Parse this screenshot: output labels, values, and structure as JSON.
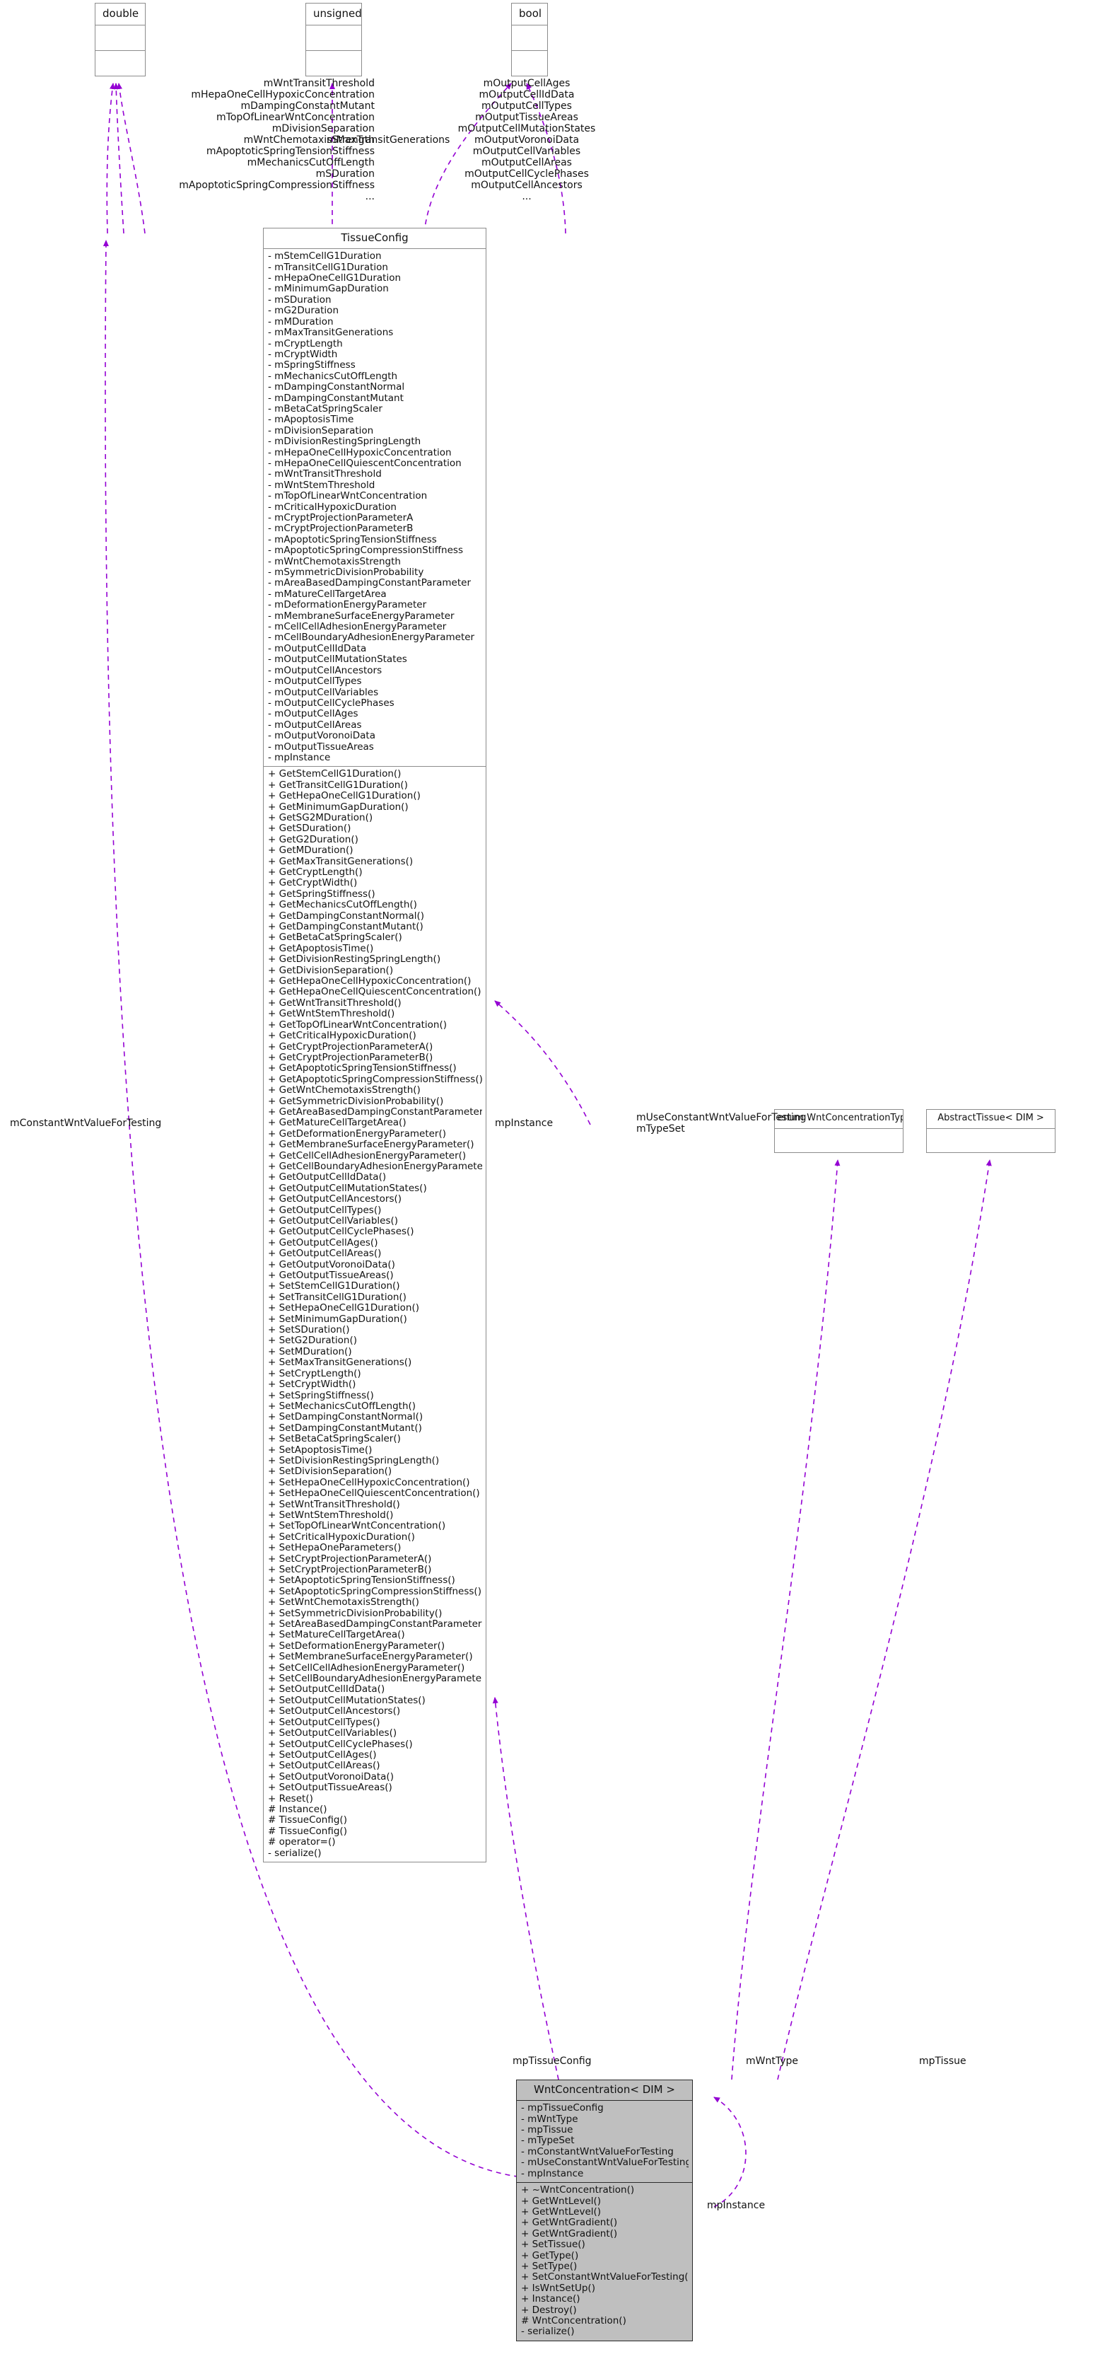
{
  "diagram": {
    "kind": "uml-class-collaboration-diagram",
    "edge_color": "#9400d3",
    "node_border": "#8c8c8c",
    "node_fill_highlight": "#bfbfbf"
  },
  "nodes": {
    "double": {
      "title": "double",
      "attributes": [],
      "operations": []
    },
    "unsigned": {
      "title": "unsigned",
      "attributes": [],
      "operations": []
    },
    "bool": {
      "title": "bool",
      "attributes": [],
      "operations": []
    },
    "wnt_concentration_type": {
      "title": "enum WntConcentrationType_",
      "attributes": [],
      "operations": []
    },
    "abstract_tissue": {
      "title": "AbstractTissue< DIM >",
      "attributes": [],
      "operations": []
    },
    "tissue_config": {
      "title": "TissueConfig",
      "attributes": [
        "- mStemCellG1Duration",
        "- mTransitCellG1Duration",
        "- mHepaOneCellG1Duration",
        "- mMinimumGapDuration",
        "- mSDuration",
        "- mG2Duration",
        "- mMDuration",
        "- mMaxTransitGenerations",
        "- mCryptLength",
        "- mCryptWidth",
        "- mSpringStiffness",
        "- mMechanicsCutOffLength",
        "- mDampingConstantNormal",
        "- mDampingConstantMutant",
        "- mBetaCatSpringScaler",
        "- mApoptosisTime",
        "- mDivisionSeparation",
        "- mDivisionRestingSpringLength",
        "- mHepaOneCellHypoxicConcentration",
        "- mHepaOneCellQuiescentConcentration",
        "- mWntTransitThreshold",
        "- mWntStemThreshold",
        "- mTopOfLinearWntConcentration",
        "- mCriticalHypoxicDuration",
        "- mCryptProjectionParameterA",
        "- mCryptProjectionParameterB",
        "- mApoptoticSpringTensionStiffness",
        "- mApoptoticSpringCompressionStiffness",
        "- mWntChemotaxisStrength",
        "- mSymmetricDivisionProbability",
        "- mAreaBasedDampingConstantParameter",
        "- mMatureCellTargetArea",
        "- mDeformationEnergyParameter",
        "- mMembraneSurfaceEnergyParameter",
        "- mCellCellAdhesionEnergyParameter",
        "- mCellBoundaryAdhesionEnergyParameter",
        "- mOutputCellIdData",
        "- mOutputCellMutationStates",
        "- mOutputCellAncestors",
        "- mOutputCellTypes",
        "- mOutputCellVariables",
        "- mOutputCellCyclePhases",
        "- mOutputCellAges",
        "- mOutputCellAreas",
        "- mOutputVoronoiData",
        "- mOutputTissueAreas",
        "- mpInstance"
      ],
      "operations": [
        "+ GetStemCellG1Duration()",
        "+ GetTransitCellG1Duration()",
        "+ GetHepaOneCellG1Duration()",
        "+ GetMinimumGapDuration()",
        "+ GetSG2MDuration()",
        "+ GetSDuration()",
        "+ GetG2Duration()",
        "+ GetMDuration()",
        "+ GetMaxTransitGenerations()",
        "+ GetCryptLength()",
        "+ GetCryptWidth()",
        "+ GetSpringStiffness()",
        "+ GetMechanicsCutOffLength()",
        "+ GetDampingConstantNormal()",
        "+ GetDampingConstantMutant()",
        "+ GetBetaCatSpringScaler()",
        "+ GetApoptosisTime()",
        "+ GetDivisionRestingSpringLength()",
        "+ GetDivisionSeparation()",
        "+ GetHepaOneCellHypoxicConcentration()",
        "+ GetHepaOneCellQuiescentConcentration()",
        "+ GetWntTransitThreshold()",
        "+ GetWntStemThreshold()",
        "+ GetTopOfLinearWntConcentration()",
        "+ GetCriticalHypoxicDuration()",
        "+ GetCryptProjectionParameterA()",
        "+ GetCryptProjectionParameterB()",
        "+ GetApoptoticSpringTensionStiffness()",
        "+ GetApoptoticSpringCompressionStiffness()",
        "+ GetWntChemotaxisStrength()",
        "+ GetSymmetricDivisionProbability()",
        "+ GetAreaBasedDampingConstantParameter()",
        "+ GetMatureCellTargetArea()",
        "+ GetDeformationEnergyParameter()",
        "+ GetMembraneSurfaceEnergyParameter()",
        "+ GetCellCellAdhesionEnergyParameter()",
        "+ GetCellBoundaryAdhesionEnergyParameter()",
        "+ GetOutputCellIdData()",
        "+ GetOutputCellMutationStates()",
        "+ GetOutputCellAncestors()",
        "+ GetOutputCellTypes()",
        "+ GetOutputCellVariables()",
        "+ GetOutputCellCyclePhases()",
        "+ GetOutputCellAges()",
        "+ GetOutputCellAreas()",
        "+ GetOutputVoronoiData()",
        "+ GetOutputTissueAreas()",
        "+ SetStemCellG1Duration()",
        "+ SetTransitCellG1Duration()",
        "+ SetHepaOneCellG1Duration()",
        "+ SetMinimumGapDuration()",
        "+ SetSDuration()",
        "+ SetG2Duration()",
        "+ SetMDuration()",
        "+ SetMaxTransitGenerations()",
        "+ SetCryptLength()",
        "+ SetCryptWidth()",
        "+ SetSpringStiffness()",
        "+ SetMechanicsCutOffLength()",
        "+ SetDampingConstantNormal()",
        "+ SetDampingConstantMutant()",
        "+ SetBetaCatSpringScaler()",
        "+ SetApoptosisTime()",
        "+ SetDivisionRestingSpringLength()",
        "+ SetDivisionSeparation()",
        "+ SetHepaOneCellHypoxicConcentration()",
        "+ SetHepaOneCellQuiescentConcentration()",
        "+ SetWntTransitThreshold()",
        "+ SetWntStemThreshold()",
        "+ SetTopOfLinearWntConcentration()",
        "+ SetCriticalHypoxicDuration()",
        "+ SetHepaOneParameters()",
        "+ SetCryptProjectionParameterA()",
        "+ SetCryptProjectionParameterB()",
        "+ SetApoptoticSpringTensionStiffness()",
        "+ SetApoptoticSpringCompressionStiffness()",
        "+ SetWntChemotaxisStrength()",
        "+ SetSymmetricDivisionProbability()",
        "+ SetAreaBasedDampingConstantParameter()",
        "+ SetMatureCellTargetArea()",
        "+ SetDeformationEnergyParameter()",
        "+ SetMembraneSurfaceEnergyParameter()",
        "+ SetCellCellAdhesionEnergyParameter()",
        "+ SetCellBoundaryAdhesionEnergyParameter()",
        "+ SetOutputCellIdData()",
        "+ SetOutputCellMutationStates()",
        "+ SetOutputCellAncestors()",
        "+ SetOutputCellTypes()",
        "+ SetOutputCellVariables()",
        "+ SetOutputCellCyclePhases()",
        "+ SetOutputCellAges()",
        "+ SetOutputCellAreas()",
        "+ SetOutputVoronoiData()",
        "+ SetOutputTissueAreas()",
        "+ Reset()",
        "# Instance()",
        "# TissueConfig()",
        "# TissueConfig()",
        "# operator=()",
        "- serialize()"
      ]
    },
    "wnt_concentration": {
      "title": "WntConcentration< DIM >",
      "attributes": [
        "- mpTissueConfig",
        "- mWntType",
        "- mpTissue",
        "- mTypeSet",
        "- mConstantWntValueForTesting",
        "- mUseConstantWntValueForTesting",
        "- mpInstance"
      ],
      "operations": [
        "+ ~WntConcentration()",
        "+ GetWntLevel()",
        "+ GetWntLevel()",
        "+ GetWntGradient()",
        "+ GetWntGradient()",
        "+ SetTissue()",
        "+ GetType()",
        "+ SetType()",
        "+ SetConstantWntValueForTesting()",
        "+ IsWntSetUp()",
        "+ Instance()",
        "+ Destroy()",
        "# WntConcentration()",
        "- serialize()"
      ]
    }
  },
  "edge_labels": {
    "double_fields": "mWntTransitThreshold\nmHepaOneCellHypoxicConcentration\nmDampingConstantMutant\nmTopOfLinearWntConcentration\nmDivisionSeparation\nmWntChemotaxisStrength\nmApoptoticSpringTensionStiffness\nmMechanicsCutOffLength\nmSDuration\nmApoptoticSpringCompressionStiffness\n...",
    "unsigned_fields": "mMaxTransitGenerations",
    "bool_fields": "mOutputCellAges\nmOutputCellIdData\nmOutputCellTypes\nmOutputTissueAreas\nmOutputCellMutationStates\nmOutputVoronoiData\nmOutputCellVariables\nmOutputCellAreas\nmOutputCellCyclePhases\nmOutputCellAncestors\n...",
    "constant_wnt_value": "mConstantWntValueForTesting",
    "tissue_config_instance": "mpInstance",
    "use_constant_wnt": "mUseConstantWntValueForTesting\nmTypeSet",
    "tissue_config_ref": "mpTissueConfig",
    "wnt_type_ref": "mWntType",
    "tissue_ref": "mpTissue",
    "wnt_instance": "mpInstance"
  }
}
